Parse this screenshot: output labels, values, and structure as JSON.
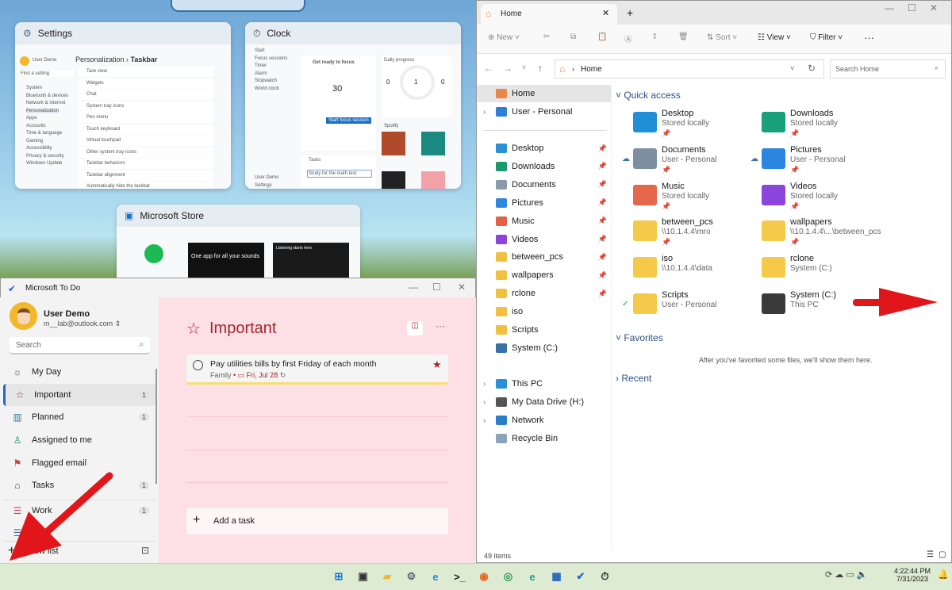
{
  "task_view": {
    "settings": {
      "title": "Settings",
      "breadcrumb": "Personalization",
      "page": "Taskbar",
      "nav": [
        "System",
        "Bluetooth & devices",
        "Network & internet",
        "Personalization",
        "Apps",
        "Accounts",
        "Time & language",
        "Gaming",
        "Accessibility",
        "Privacy & security",
        "Windows Update"
      ],
      "rows": [
        "Task view",
        "Widgets",
        "Chat",
        "System tray icons",
        "Pen menu",
        "Touch keyboard",
        "Virtual touchpad",
        "Other system tray icons",
        "Taskbar behaviors",
        "Taskbar alignment",
        "Automatically hide the taskbar"
      ],
      "search": "Find a setting",
      "user": "User Demo"
    },
    "clock": {
      "title": "Clock",
      "nav": [
        "Start",
        "Focus sessions",
        "Timer",
        "Alarm",
        "Stopwatch",
        "World clock"
      ],
      "heading": "Get ready to focus",
      "minutes": "30",
      "start_label": "Start focus session",
      "daily_progress": "Daily progress",
      "yesterday": "0",
      "daily_goal": "1",
      "streak": "0",
      "tasks": "Tasks",
      "task_item": "Study for the math test",
      "spotify": "Spotify",
      "user": "User Demo",
      "settings": "Settings"
    },
    "store": {
      "title": "Microsoft Store",
      "promo": "One app for all your sounds",
      "promo2": "Listening starts here"
    }
  },
  "todo": {
    "title": "Microsoft To Do",
    "user_name": "User Demo",
    "user_email": "m__lab@outlook.com",
    "search_placeholder": "Search",
    "nav": [
      {
        "label": "My Day",
        "icon": "☼",
        "count": ""
      },
      {
        "label": "Important",
        "icon": "☆",
        "count": "1"
      },
      {
        "label": "Planned",
        "icon": "▥",
        "count": "1"
      },
      {
        "label": "Assigned to me",
        "icon": "♙",
        "count": ""
      },
      {
        "label": "Flagged email",
        "icon": "⚑",
        "count": ""
      },
      {
        "label": "Tasks",
        "icon": "⌂",
        "count": "1"
      }
    ],
    "lists": [
      {
        "label": "Work",
        "count": "1"
      },
      {
        "label": "Pe",
        "count": ""
      }
    ],
    "new_list": "New list",
    "list_title": "Important",
    "task": {
      "title": "Pay utilities bills by first Friday of each month",
      "list": "Family",
      "due": "Fri, Jul 28",
      "important": true
    },
    "add_task": "Add a task",
    "accent": "#a4262c"
  },
  "explorer": {
    "tab": "Home",
    "toolbar": {
      "new": "New",
      "sort": "Sort",
      "view": "View",
      "filter": "Filter"
    },
    "address": "Home",
    "search_placeholder": "Search Home",
    "nav_top": [
      {
        "label": "Home",
        "color": "#e8884a"
      },
      {
        "label": "User - Personal",
        "color": "#2f7fd8"
      }
    ],
    "nav_pinned": [
      {
        "label": "Desktop",
        "color": "#2a8fd6"
      },
      {
        "label": "Downloads",
        "color": "#1c9a6c"
      },
      {
        "label": "Documents",
        "color": "#8a9aab"
      },
      {
        "label": "Pictures",
        "color": "#2e86de"
      },
      {
        "label": "Music",
        "color": "#e0604a"
      },
      {
        "label": "Videos",
        "color": "#8a44d8"
      },
      {
        "label": "between_pcs",
        "color": "#f2c040"
      },
      {
        "label": "wallpapers",
        "color": "#f2c040"
      },
      {
        "label": "rclone",
        "color": "#f2c040"
      },
      {
        "label": "iso",
        "color": "#f2c040"
      },
      {
        "label": "Scripts",
        "color": "#f2c040"
      },
      {
        "label": "System (C:)",
        "color": "#3a6fa8"
      }
    ],
    "nav_bottom": [
      {
        "label": "This PC",
        "color": "#2a8fd6"
      },
      {
        "label": "My Data Drive (H:)",
        "color": "#555555"
      },
      {
        "label": "Network",
        "color": "#2a7fc8"
      },
      {
        "label": "Recycle Bin",
        "color": "#8aa3bb"
      }
    ],
    "quick_access_title": "Quick access",
    "quick_access": [
      {
        "name": "Desktop",
        "sub": "Stored locally",
        "pinned": true,
        "color": "#1f8fd8",
        "cloud": false
      },
      {
        "name": "Downloads",
        "sub": "Stored locally",
        "pinned": true,
        "color": "#17a07a",
        "cloud": false
      },
      {
        "name": "Documents",
        "sub": "User - Personal",
        "pinned": true,
        "color": "#7e8fa3",
        "cloud": true
      },
      {
        "name": "Pictures",
        "sub": "User - Personal",
        "pinned": true,
        "color": "#2b86e0",
        "cloud": true
      },
      {
        "name": "Music",
        "sub": "Stored locally",
        "pinned": true,
        "color": "#e5674c",
        "cloud": false
      },
      {
        "name": "Videos",
        "sub": "Stored locally",
        "pinned": true,
        "color": "#8b45dd",
        "cloud": false
      },
      {
        "name": "between_pcs",
        "sub": "\\\\10.1.4.4\\mro",
        "pinned": true,
        "color": "#f5c94a",
        "cloud": false
      },
      {
        "name": "wallpapers",
        "sub": "\\\\10.1.4.4\\...\\between_pcs",
        "pinned": true,
        "color": "#f5c94a",
        "cloud": false
      },
      {
        "name": "iso",
        "sub": "\\\\10.1.4.4\\data",
        "pinned": false,
        "color": "#f5c94a",
        "cloud": false
      },
      {
        "name": "rclone",
        "sub": "System (C:)",
        "pinned": false,
        "color": "#f5c94a",
        "cloud": false
      },
      {
        "name": "Scripts",
        "sub": "User - Personal",
        "pinned": false,
        "color": "#f5c94a",
        "cloud": false,
        "synced": true
      },
      {
        "name": "System (C:)",
        "sub": "This PC",
        "pinned": false,
        "color": "#3a3a3a",
        "cloud": false
      }
    ],
    "favorites_title": "Favorites",
    "favorites_empty": "After you've favorited some files, we'll show them here.",
    "recent_title": "Recent",
    "status": "49 items"
  },
  "taskbar": {
    "apps": [
      "start",
      "task-view",
      "file-explorer",
      "settings",
      "edge",
      "terminal",
      "firefox",
      "chrome",
      "edge-can",
      "store",
      "todo",
      "clock"
    ],
    "time": "4:22:44 PM",
    "date": "7/31/2023"
  }
}
